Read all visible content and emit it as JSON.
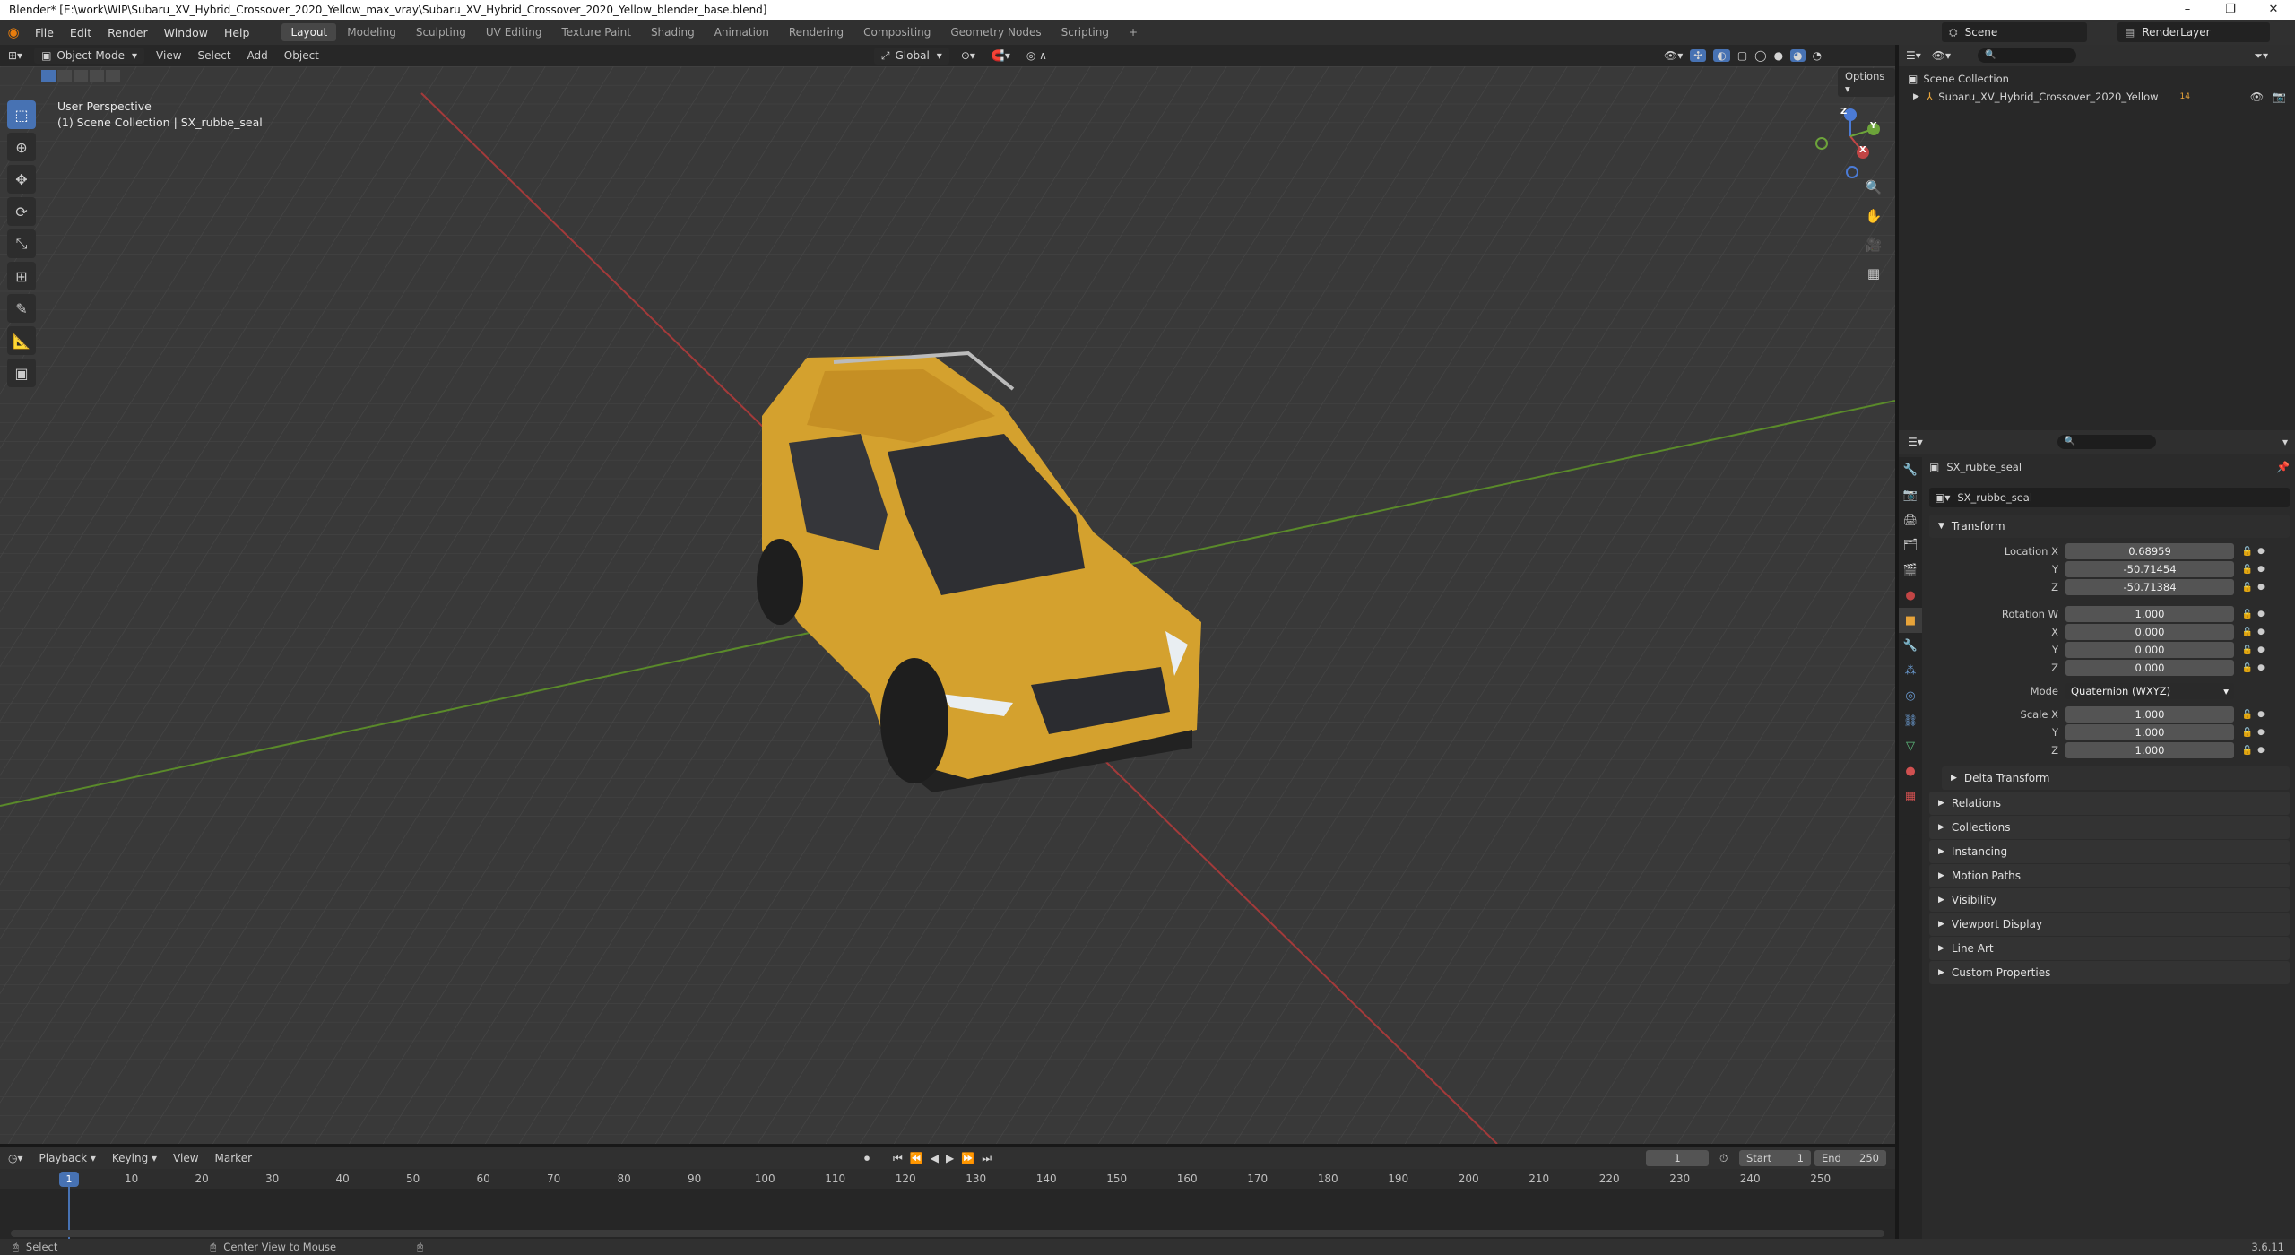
{
  "window": {
    "title": "Blender* [E:\\work\\WIP\\Subaru_XV_Hybrid_Crossover_2020_Yellow_max_vray\\Subaru_XV_Hybrid_Crossover_2020_Yellow_blender_base.blend]",
    "minimize": "–",
    "maximize": "❐",
    "close": "✕"
  },
  "menu": [
    "File",
    "Edit",
    "Render",
    "Window",
    "Help"
  ],
  "workspaces": [
    "Layout",
    "Modeling",
    "Sculpting",
    "UV Editing",
    "Texture Paint",
    "Shading",
    "Animation",
    "Rendering",
    "Compositing",
    "Geometry Nodes",
    "Scripting"
  ],
  "active_workspace": "Layout",
  "add_workspace": "+",
  "scene": {
    "name": "Scene",
    "view_layer": "RenderLayer"
  },
  "viewport": {
    "mode": "Object Mode",
    "menus": [
      "View",
      "Select",
      "Add",
      "Object"
    ],
    "transform_orientation": "Global",
    "options": "Options",
    "view_name": "User Perspective",
    "collection_path": "(1) Scene Collection | SX_rubbe_seal",
    "gizmo": {
      "x": "X",
      "y": "Y",
      "z": "Z"
    }
  },
  "outliner": {
    "root": "Scene Collection",
    "items": [
      {
        "name": "Subaru_XV_Hybrid_Crossover_2020_Yellow",
        "badge": "14"
      }
    ]
  },
  "properties": {
    "object_name": "SX_rubbe_seal",
    "data_name": "SX_rubbe_seal",
    "transform_title": "Transform",
    "location": {
      "label": "Location X",
      "x": "0.68959",
      "y": "-50.71454",
      "z": "-50.71384"
    },
    "rotation": {
      "label": "Rotation W",
      "w": "1.000",
      "x": "0.000",
      "y": "0.000",
      "z": "0.000"
    },
    "mode": {
      "label": "Mode",
      "value": "Quaternion (WXYZ)"
    },
    "scale": {
      "label": "Scale X",
      "x": "1.000",
      "y": "1.000",
      "z": "1.000"
    },
    "axis_labels": {
      "x": "X",
      "y": "Y",
      "z": "Z"
    },
    "delta": "Delta Transform",
    "panels": [
      "Relations",
      "Collections",
      "Instancing",
      "Motion Paths",
      "Visibility",
      "Viewport Display",
      "Line Art",
      "Custom Properties"
    ]
  },
  "timeline": {
    "menus": [
      "Playback",
      "Keying",
      "View",
      "Marker"
    ],
    "current_frame": "1",
    "start_label": "Start",
    "start": "1",
    "end_label": "End",
    "end": "250",
    "ticks": [
      "10",
      "20",
      "30",
      "40",
      "50",
      "60",
      "70",
      "80",
      "90",
      "100",
      "110",
      "120",
      "130",
      "140",
      "150",
      "160",
      "170",
      "180",
      "190",
      "200",
      "210",
      "220",
      "230",
      "240",
      "250"
    ]
  },
  "status": {
    "select": "Select",
    "center": "Center View to Mouse",
    "version": "3.6.11"
  },
  "colors": {
    "accent": "#4772b3",
    "car_body": "#d4a12e",
    "x_axis": "#a33a3a",
    "y_axis": "#5a8a2a",
    "grid_bg": "#3a3a3a"
  }
}
